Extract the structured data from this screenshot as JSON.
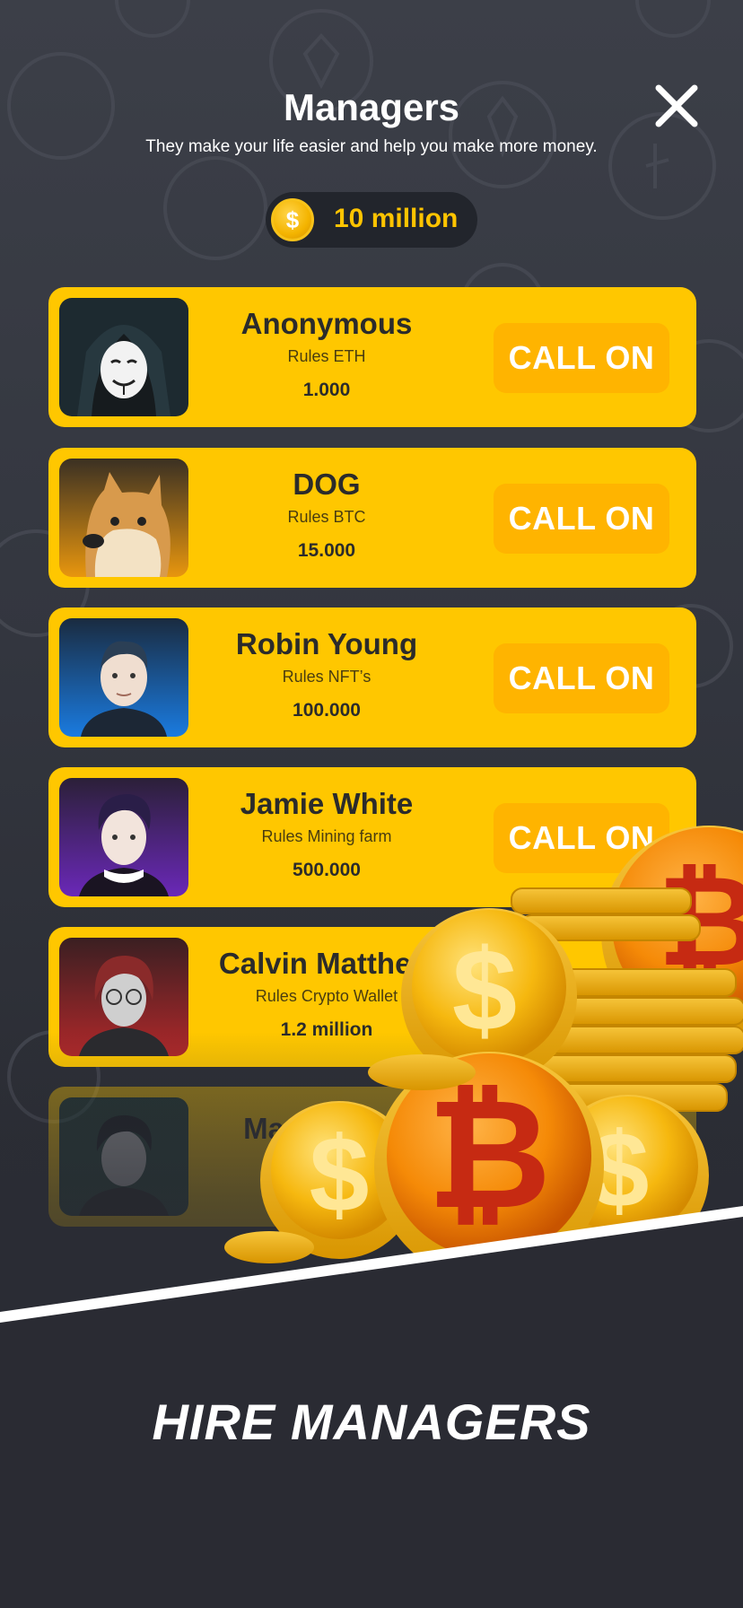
{
  "header": {
    "title": "Managers",
    "subtitle": "They make your life easier and help you make more money."
  },
  "balance": {
    "currency_icon": "dollar-coin-icon",
    "amount": "10 million"
  },
  "managers": [
    {
      "name": "Anonymous",
      "rules": "Rules ETH",
      "price": "1.000",
      "button": "CALL ON"
    },
    {
      "name": "DOG",
      "rules": "Rules BTC",
      "price": "15.000",
      "button": "CALL ON"
    },
    {
      "name": "Robin Young",
      "rules": "Rules NFT’s",
      "price": "100.000",
      "button": "CALL ON"
    },
    {
      "name": "Jamie White",
      "rules": "Rules Mining farm",
      "price": "500.000",
      "button": "CALL ON"
    },
    {
      "name": "Calvin Matthew",
      "rules": "Rules Crypto Wallet",
      "price": "1.2 million"
    },
    {
      "name": "Ma"
    }
  ],
  "promo": {
    "tagline": "HIRE MANAGERS"
  },
  "colors": {
    "card": "#ffc700",
    "button": "#ffb400",
    "balance_text": "#ffc400",
    "background": "#2a2c34"
  }
}
